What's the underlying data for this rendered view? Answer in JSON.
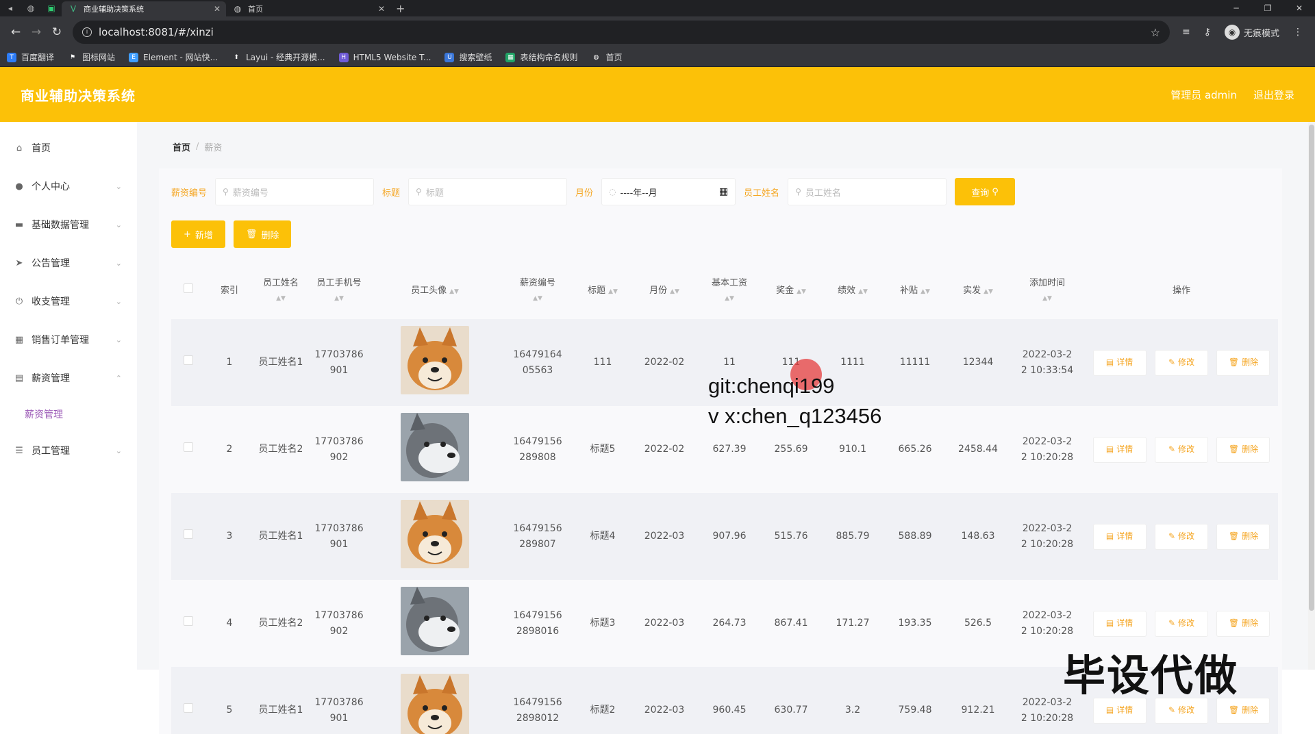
{
  "browser": {
    "tabs": [
      {
        "title": "商业辅助决策系统",
        "active": true
      },
      {
        "title": "首页",
        "active": false
      }
    ],
    "url": "localhost:8081/#/xinzi",
    "incognito_label": "无痕模式",
    "bookmarks": [
      "百度翻译",
      "图标网站",
      "Element - 网站快...",
      "Layui - 经典开源模...",
      "HTML5 Website T...",
      "搜索壁纸",
      "表结构命名规则",
      "首页"
    ]
  },
  "header": {
    "title": "商业辅助决策系统",
    "user": "管理员 admin",
    "logout": "退出登录",
    "accent": "#fcc108"
  },
  "sidebar": {
    "items": [
      {
        "label": "首页",
        "icon": "home-icon"
      },
      {
        "label": "个人中心",
        "icon": "user-icon"
      },
      {
        "label": "基础数据管理",
        "icon": "monitor-icon"
      },
      {
        "label": "公告管理",
        "icon": "send-icon"
      },
      {
        "label": "收支管理",
        "icon": "power-icon"
      },
      {
        "label": "销售订单管理",
        "icon": "grid-icon"
      },
      {
        "label": "薪资管理",
        "icon": "doc-icon"
      },
      {
        "label": "员工管理",
        "icon": "menu-icon"
      }
    ],
    "sub_item": "薪资管理"
  },
  "breadcrumb": {
    "home": "首页",
    "current": "薪资"
  },
  "search": {
    "label1": "薪资编号",
    "placeholder1": "薪资编号",
    "label2": "标题",
    "placeholder2": "标题",
    "label3": "月份",
    "date_value": "----年--月",
    "label4": "员工姓名",
    "placeholder4": "员工姓名",
    "query": "查询"
  },
  "actions": {
    "add": "新增",
    "delete": "删除"
  },
  "table": {
    "headers": [
      "索引",
      "员工姓名",
      "员工手机号",
      "员工头像",
      "薪资编号",
      "标题",
      "月份",
      "基本工资",
      "奖金",
      "绩效",
      "补贴",
      "实发",
      "添加时间",
      "操作"
    ],
    "rows": [
      {
        "idx": "1",
        "name": "员工姓名1",
        "phone": [
          "17703786",
          "901"
        ],
        "avatar": "shiba",
        "code": [
          "16479164",
          "05563"
        ],
        "title": "111",
        "month": "2022-02",
        "base": "11",
        "bonus": "111",
        "perf": "1111",
        "subsidy": "11111",
        "net": "12344",
        "time": [
          "2022-03-2",
          "2 10:33:54"
        ]
      },
      {
        "idx": "2",
        "name": "员工姓名2",
        "phone": [
          "17703786",
          "902"
        ],
        "avatar": "husky",
        "code": [
          "16479156",
          "289808"
        ],
        "title": "标题5",
        "month": "2022-02",
        "base": "627.39",
        "bonus": "255.69",
        "perf": "910.1",
        "subsidy": "665.26",
        "net": "2458.44",
        "time": [
          "2022-03-2",
          "2 10:20:28"
        ]
      },
      {
        "idx": "3",
        "name": "员工姓名1",
        "phone": [
          "17703786",
          "901"
        ],
        "avatar": "shiba",
        "code": [
          "16479156",
          "289807"
        ],
        "title": "标题4",
        "month": "2022-03",
        "base": "907.96",
        "bonus": "515.76",
        "perf": "885.79",
        "subsidy": "588.89",
        "net": "148.63",
        "time": [
          "2022-03-2",
          "2 10:20:28"
        ]
      },
      {
        "idx": "4",
        "name": "员工姓名2",
        "phone": [
          "17703786",
          "902"
        ],
        "avatar": "husky",
        "code": [
          "16479156",
          "2898016"
        ],
        "title": "标题3",
        "month": "2022-03",
        "base": "264.73",
        "bonus": "867.41",
        "perf": "171.27",
        "subsidy": "193.35",
        "net": "526.5",
        "time": [
          "2022-03-2",
          "2 10:20:28"
        ]
      },
      {
        "idx": "5",
        "name": "员工姓名1",
        "phone": [
          "17703786",
          "901"
        ],
        "avatar": "shiba",
        "code": [
          "16479156",
          "2898012"
        ],
        "title": "标题2",
        "month": "2022-03",
        "base": "960.45",
        "bonus": "630.77",
        "perf": "3.2",
        "subsidy": "759.48",
        "net": "912.21",
        "time": [
          "2022-03-2",
          "2 10:20:28"
        ]
      }
    ],
    "ops": {
      "detail": "详情",
      "edit": "修改",
      "delete": "删除"
    }
  },
  "overlay": {
    "line1": "git:chenqi199",
    "line2": "v x:chen_q123456",
    "stamp": "毕设代做"
  }
}
